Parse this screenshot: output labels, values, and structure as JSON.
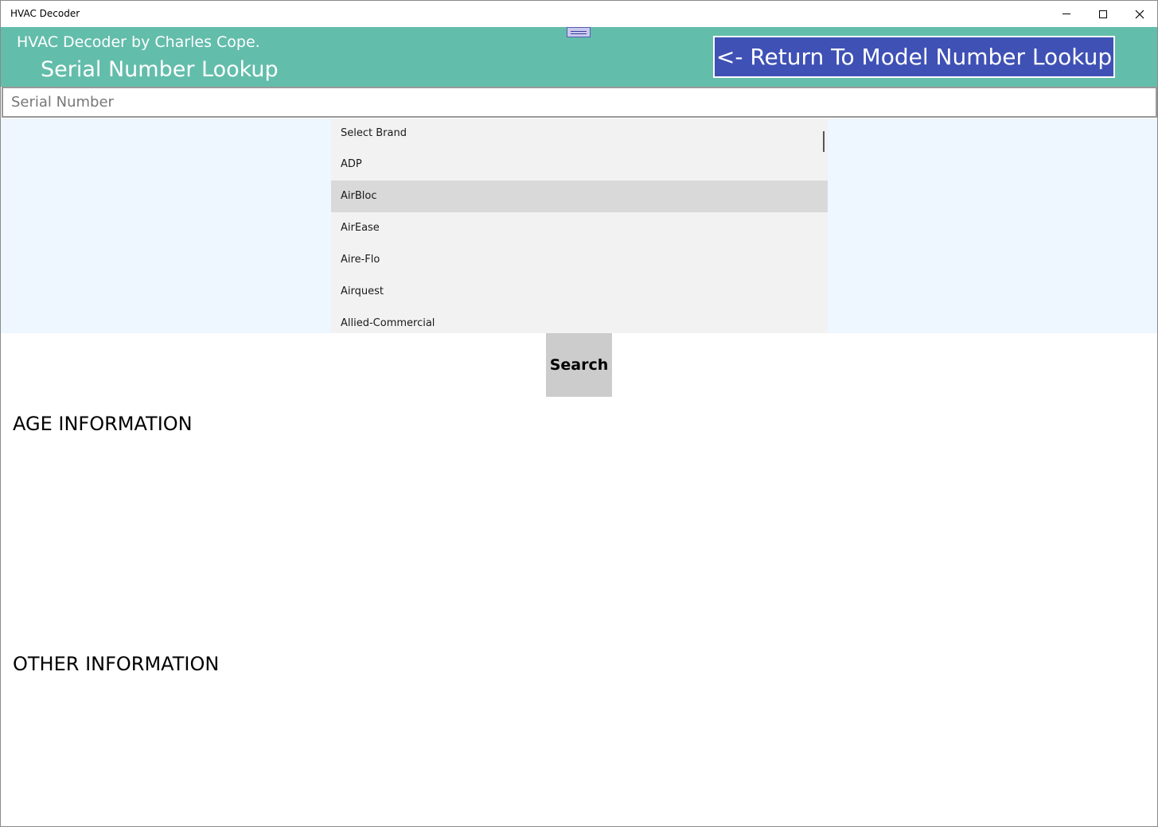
{
  "window": {
    "title": "HVAC Decoder"
  },
  "header": {
    "app_name": "HVAC Decoder by Charles Cope.",
    "page_title": "Serial Number Lookup",
    "return_button_label": "<- Return To Model Number Lookup"
  },
  "serial": {
    "placeholder": "Serial Number",
    "value": ""
  },
  "brands": {
    "selected": "AirBloc",
    "items": [
      {
        "label": "Select Brand"
      },
      {
        "label": "ADP"
      },
      {
        "label": "AirBloc"
      },
      {
        "label": "AirEase"
      },
      {
        "label": "Aire-Flo"
      },
      {
        "label": "Airquest"
      },
      {
        "label": "Allied-Commercial"
      }
    ]
  },
  "search_button_label": "Search",
  "sections": {
    "age": "AGE INFORMATION",
    "other": "OTHER INFORMATION"
  },
  "colors": {
    "header_bg": "#63bdab",
    "return_button_bg": "#3f51b5",
    "brand_area_bg": "#eef6ff",
    "selected_item_bg": "#d9d9d9"
  }
}
